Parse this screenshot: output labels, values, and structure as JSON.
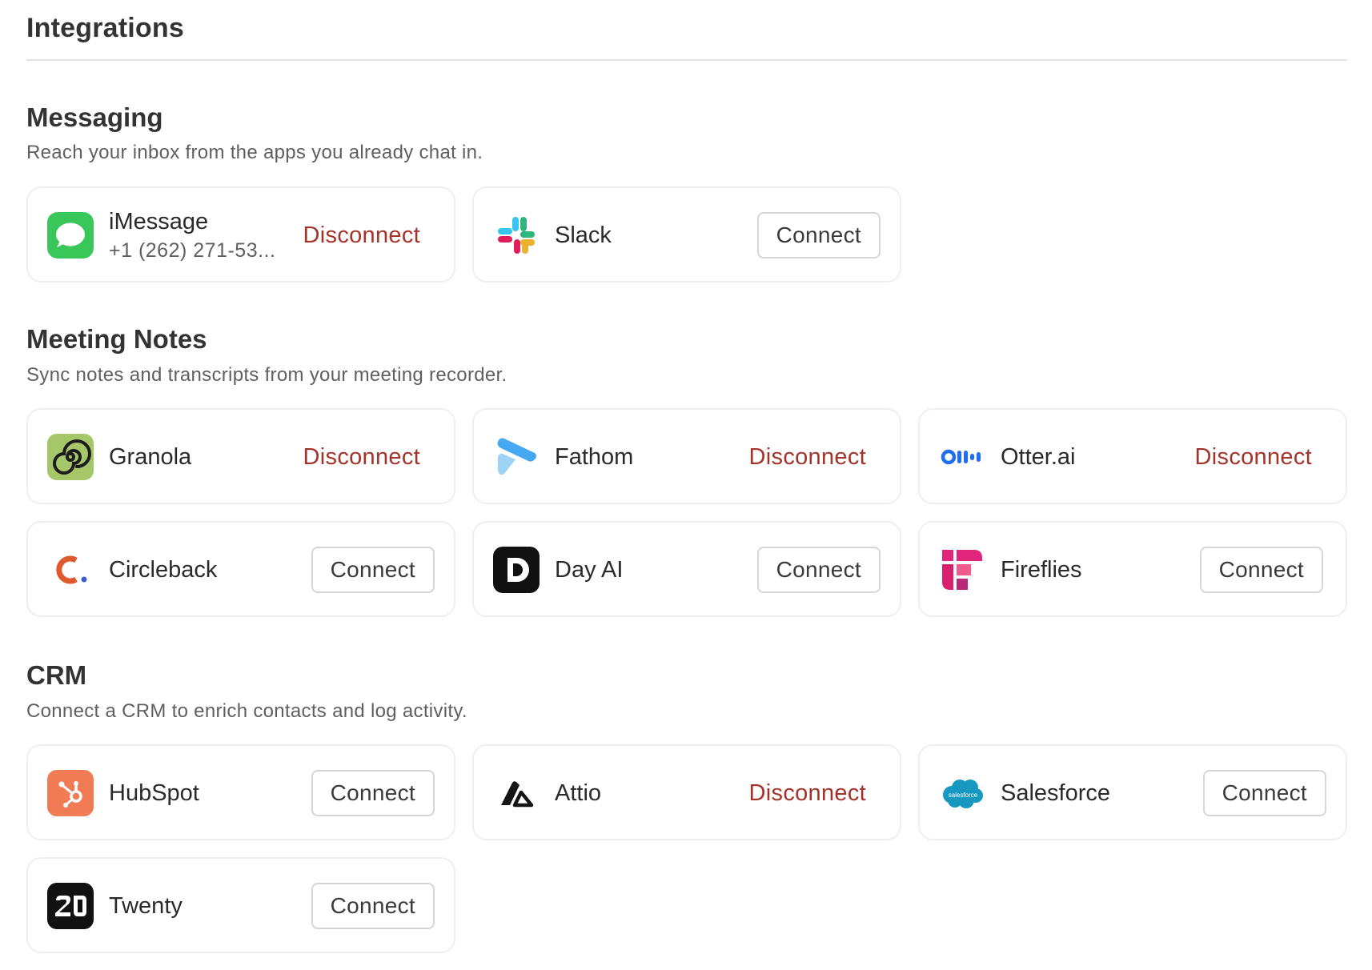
{
  "page": {
    "title": "Integrations"
  },
  "labels": {
    "connect": "Connect",
    "disconnect": "Disconnect"
  },
  "colors": {
    "disconnect": "#a4342a",
    "border": "#efefef"
  },
  "sections": {
    "messaging": {
      "title": "Messaging",
      "description": "Reach your inbox from the apps you already chat in.",
      "items": {
        "imessage": {
          "name": "iMessage",
          "detail": "+1 (262) 271-53...",
          "status": "connected",
          "icon": "imessage-icon"
        },
        "slack": {
          "name": "Slack",
          "status": "disconnected",
          "icon": "slack-icon"
        }
      }
    },
    "meeting_notes": {
      "title": "Meeting Notes",
      "description": "Sync notes and transcripts from your meeting recorder.",
      "items": {
        "granola": {
          "name": "Granola",
          "status": "connected",
          "icon": "granola-icon"
        },
        "fathom": {
          "name": "Fathom",
          "status": "connected",
          "icon": "fathom-icon"
        },
        "otter": {
          "name": "Otter.ai",
          "status": "connected",
          "icon": "otter-icon"
        },
        "circleback": {
          "name": "Circleback",
          "status": "disconnected",
          "icon": "circleback-icon"
        },
        "dayai": {
          "name": "Day AI",
          "status": "disconnected",
          "icon": "day-ai-icon"
        },
        "fireflies": {
          "name": "Fireflies",
          "status": "disconnected",
          "icon": "fireflies-icon"
        }
      }
    },
    "crm": {
      "title": "CRM",
      "description": "Connect a CRM to enrich contacts and log activity.",
      "items": {
        "hubspot": {
          "name": "HubSpot",
          "status": "disconnected",
          "icon": "hubspot-icon"
        },
        "attio": {
          "name": "Attio",
          "status": "connected",
          "icon": "attio-icon"
        },
        "salesforce": {
          "name": "Salesforce",
          "logo_text": "salesforce",
          "status": "disconnected",
          "icon": "salesforce-icon"
        },
        "twenty": {
          "name": "Twenty",
          "status": "disconnected",
          "icon": "twenty-icon"
        }
      }
    }
  }
}
